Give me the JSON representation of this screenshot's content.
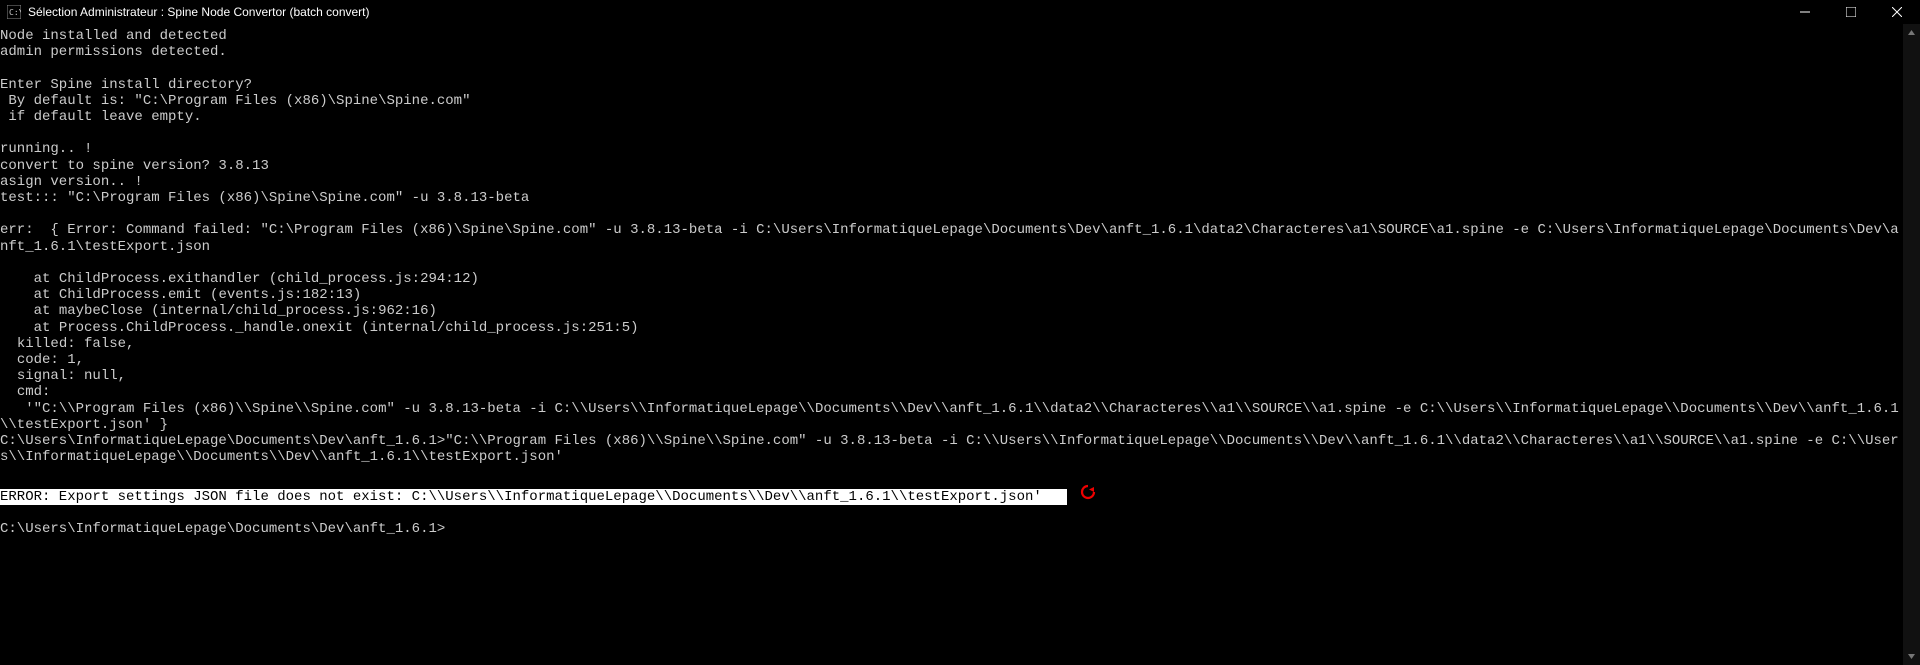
{
  "titlebar": {
    "title": "Sélection Administrateur :  Spine Node Convertor (batch convert)"
  },
  "terminal": {
    "lines": [
      "Node installed and detected",
      "admin permissions detected.",
      "",
      "Enter Spine install directory?",
      " By default is: \"C:\\Program Files (x86)\\Spine\\Spine.com\"",
      " if default leave empty.",
      "",
      "running.. !",
      "convert to spine version? 3.8.13",
      "asign version.. !",
      "test::: \"C:\\Program Files (x86)\\Spine\\Spine.com\" -u 3.8.13-beta",
      "",
      "err:  { Error: Command failed: \"C:\\Program Files (x86)\\Spine\\Spine.com\" -u 3.8.13-beta -i C:\\Users\\InformatiqueLepage\\Documents\\Dev\\anft_1.6.1\\data2\\Characteres\\a1\\SOURCE\\a1.spine -e C:\\Users\\InformatiqueLepage\\Documents\\Dev\\anft_1.6.1\\testExport.json",
      "",
      "    at ChildProcess.exithandler (child_process.js:294:12)",
      "    at ChildProcess.emit (events.js:182:13)",
      "    at maybeClose (internal/child_process.js:962:16)",
      "    at Process.ChildProcess._handle.onexit (internal/child_process.js:251:5)",
      "  killed: false,",
      "  code: 1,",
      "  signal: null,",
      "  cmd:",
      "   '\"C:\\\\Program Files (x86)\\\\Spine\\\\Spine.com\" -u 3.8.13-beta -i C:\\\\Users\\\\InformatiqueLepage\\\\Documents\\\\Dev\\\\anft_1.6.1\\\\data2\\\\Characteres\\\\a1\\\\SOURCE\\\\a1.spine -e C:\\\\Users\\\\InformatiqueLepage\\\\Documents\\\\Dev\\\\anft_1.6.1\\\\testExport.json' }",
      "C:\\Users\\InformatiqueLepage\\Documents\\Dev\\anft_1.6.1>\"C:\\\\Program Files (x86)\\\\Spine\\\\Spine.com\" -u 3.8.13-beta -i C:\\\\Users\\\\InformatiqueLepage\\\\Documents\\\\Dev\\\\anft_1.6.1\\\\data2\\\\Characteres\\\\a1\\\\SOURCE\\\\a1.spine -e C:\\\\Users\\\\InformatiqueLepage\\\\Documents\\\\Dev\\\\anft_1.6.1\\\\testExport.json'",
      ""
    ],
    "highlight": "ERROR: Export settings JSON file does not exist: C:\\\\Users\\\\InformatiqueLepage\\\\Documents\\\\Dev\\\\anft_1.6.1\\\\testExport.json'   ",
    "prompt": "C:\\Users\\InformatiqueLepage\\Documents\\Dev\\anft_1.6.1>"
  }
}
